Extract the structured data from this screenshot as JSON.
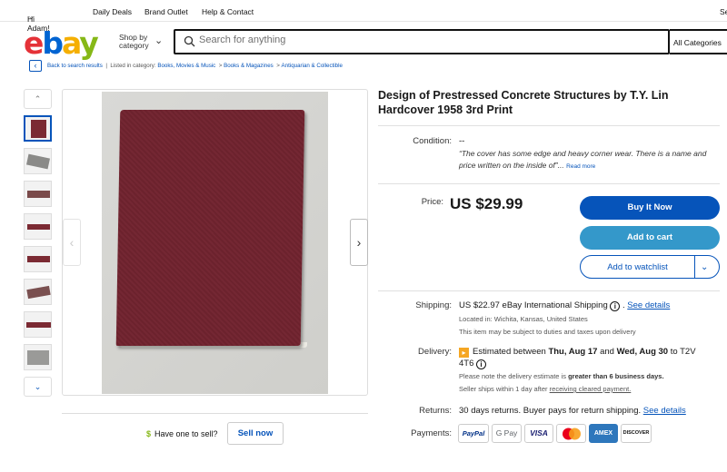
{
  "topnav": {
    "greeting": "Hi Adam!",
    "daily_deals": "Daily Deals",
    "brand_outlet": "Brand Outlet",
    "help_contact": "Help & Contact",
    "sell": "Se"
  },
  "header": {
    "logo_e": "e",
    "logo_b": "b",
    "logo_a": "a",
    "logo_y": "y",
    "shop_by": "Shop by",
    "category": "category",
    "search_placeholder": "Search for anything",
    "all_categories": "All Categories"
  },
  "breadcrumb": {
    "back": "Back to search results",
    "listed_in": "Listed in category:",
    "items": [
      "Books, Movies & Music",
      "Books & Magazines",
      "Antiquarian & Collectible"
    ]
  },
  "gallery": {
    "thumb_count": 8
  },
  "item": {
    "title": "Design of Prestressed Concrete Structures by T.Y. Lin Hardcover 1958 3rd Print",
    "condition_label": "Condition:",
    "condition_value": "--",
    "condition_desc": "“The cover has some edge and heavy corner wear. There is a name and price written on the inside of”...",
    "read_more": "Read more",
    "price_label": "Price:",
    "price": "US $29.99"
  },
  "actions": {
    "buy": "Buy It Now",
    "cart": "Add to cart",
    "watch": "Add to watchlist"
  },
  "shipping": {
    "label": "Shipping:",
    "cost": "US $22.97 eBay International Shipping",
    "see_details": "See details",
    "location": "Located in: Wichita, Kansas, United States",
    "duties": "This item may be subject to duties and taxes upon delivery"
  },
  "delivery": {
    "label": "Delivery:",
    "pre": "Estimated between",
    "date1": "Thu, Aug 17",
    "and": "and",
    "date2": "Wed, Aug 30",
    "to": "to T2V",
    "postal": "4T6",
    "note_pre": "Please note the delivery estimate is",
    "note_bold": "greater than 6 business days.",
    "ships_pre": "Seller ships within 1 day after",
    "ships_link": "receiving cleared payment."
  },
  "returns": {
    "label": "Returns:",
    "text": "30 days returns. Buyer pays for return shipping.",
    "see_details": "See details"
  },
  "payments": {
    "label": "Payments:",
    "methods": [
      "PayPal",
      "G Pay",
      "VISA",
      "",
      "AMEX",
      "DISCOVER"
    ]
  },
  "sell": {
    "question": "Have one to sell?",
    "button": "Sell now"
  },
  "colors": {
    "ebay_red": "#e53238",
    "ebay_blue": "#0064d2",
    "ebay_yellow": "#f5af02",
    "ebay_green": "#86b817",
    "primary_button": "#0654ba",
    "cart_button": "#3498ca"
  }
}
